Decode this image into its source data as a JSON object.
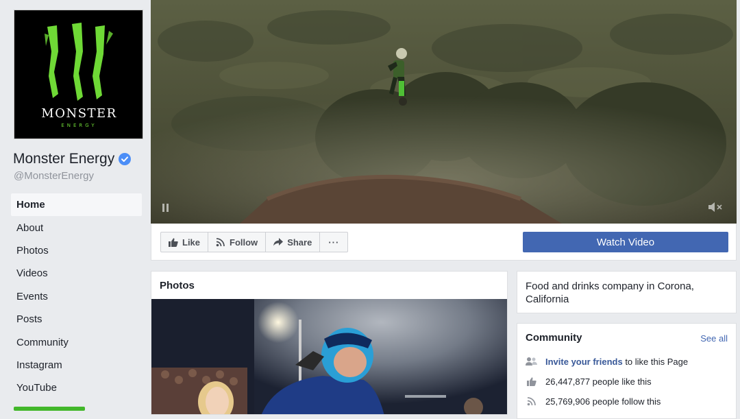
{
  "page": {
    "logo_text": "MONSTER",
    "logo_subtext": "ENERGY",
    "name": "Monster Energy",
    "handle": "@MonsterEnergy"
  },
  "nav": {
    "items": [
      {
        "label": "Home",
        "active": true
      },
      {
        "label": "About"
      },
      {
        "label": "Photos"
      },
      {
        "label": "Videos"
      },
      {
        "label": "Events"
      },
      {
        "label": "Posts"
      },
      {
        "label": "Community"
      },
      {
        "label": "Instagram"
      },
      {
        "label": "YouTube"
      }
    ]
  },
  "actions": {
    "like": "Like",
    "follow": "Follow",
    "share": "Share",
    "more": "···",
    "watch_video": "Watch Video"
  },
  "photos": {
    "title": "Photos"
  },
  "about": {
    "description": "Food and drinks company in Corona, California"
  },
  "community": {
    "title": "Community",
    "see_all": "See all",
    "invite_link": "Invite your friends",
    "invite_rest": " to like this Page",
    "likes": "26,447,877 people like this",
    "follows": "25,769,906 people follow this"
  },
  "colors": {
    "accent": "#4267b2",
    "link": "#385898",
    "verified": "#4c8ef7",
    "monster_green": "#6fd936"
  },
  "icons": [
    "verified-badge-icon",
    "pause-icon",
    "mute-icon",
    "like-icon",
    "follow-icon",
    "share-icon",
    "invite-friends-icon",
    "thumbs-up-icon",
    "rss-icon"
  ]
}
